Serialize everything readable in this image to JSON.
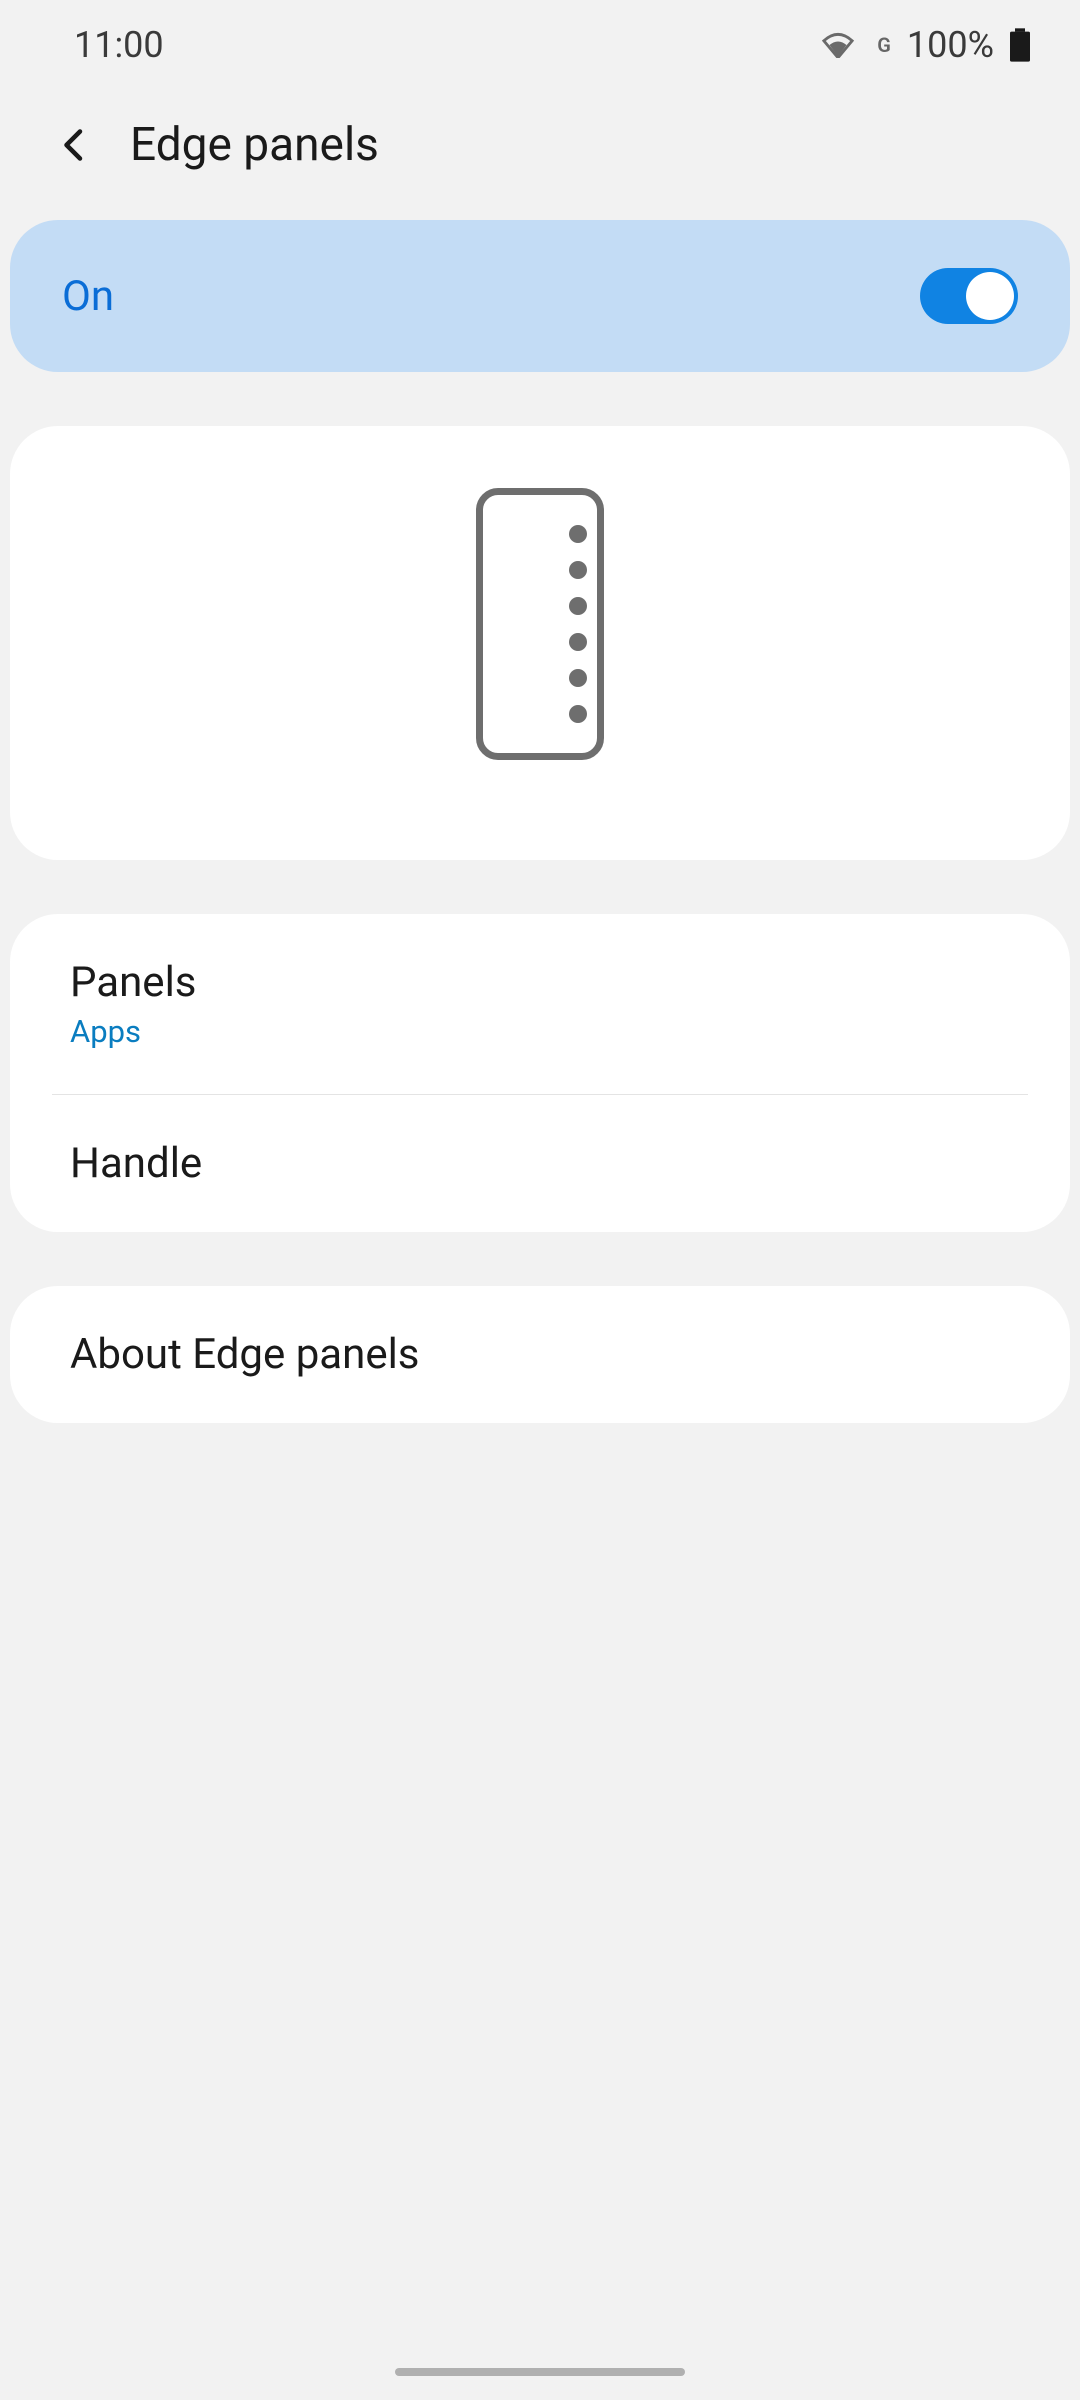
{
  "status": {
    "time": "11:00",
    "network_indicator": "G",
    "battery_percent": "100%"
  },
  "header": {
    "title": "Edge panels"
  },
  "toggle": {
    "label": "On",
    "state": "on"
  },
  "list": {
    "items": [
      {
        "title": "Panels",
        "subtitle": "Apps"
      },
      {
        "title": "Handle"
      }
    ]
  },
  "about": {
    "title": "About Edge panels"
  }
}
